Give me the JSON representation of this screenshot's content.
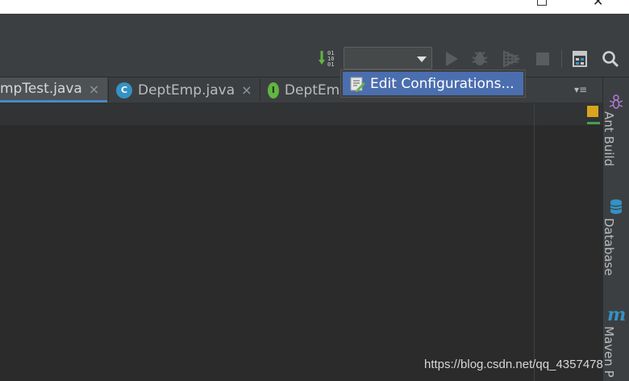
{
  "tabs": [
    {
      "label": "mpTest.java",
      "active": true
    },
    {
      "label": "DeptEmp.java",
      "badge": "C",
      "active": false
    },
    {
      "label": "DeptEmp",
      "badge": "I",
      "active": false
    }
  ],
  "tab_close_glyph": "×",
  "tabs_menu_glyph": "▾≡",
  "sort_icon_digits": [
    "01",
    "10",
    "01"
  ],
  "popup": {
    "item_label": "Edit Configurations..."
  },
  "sidebar": {
    "ant_build": "Ant Build",
    "database": "Database",
    "maven_icon_letter": "m",
    "maven": "Maven P"
  },
  "watermark": "https://blog.csdn.net/qq_4357478",
  "colors": {
    "accent": "#4b6eaf",
    "class_badge": "#3592c4",
    "interface_badge": "#62b543",
    "warning_marker": "#d9a41f"
  }
}
